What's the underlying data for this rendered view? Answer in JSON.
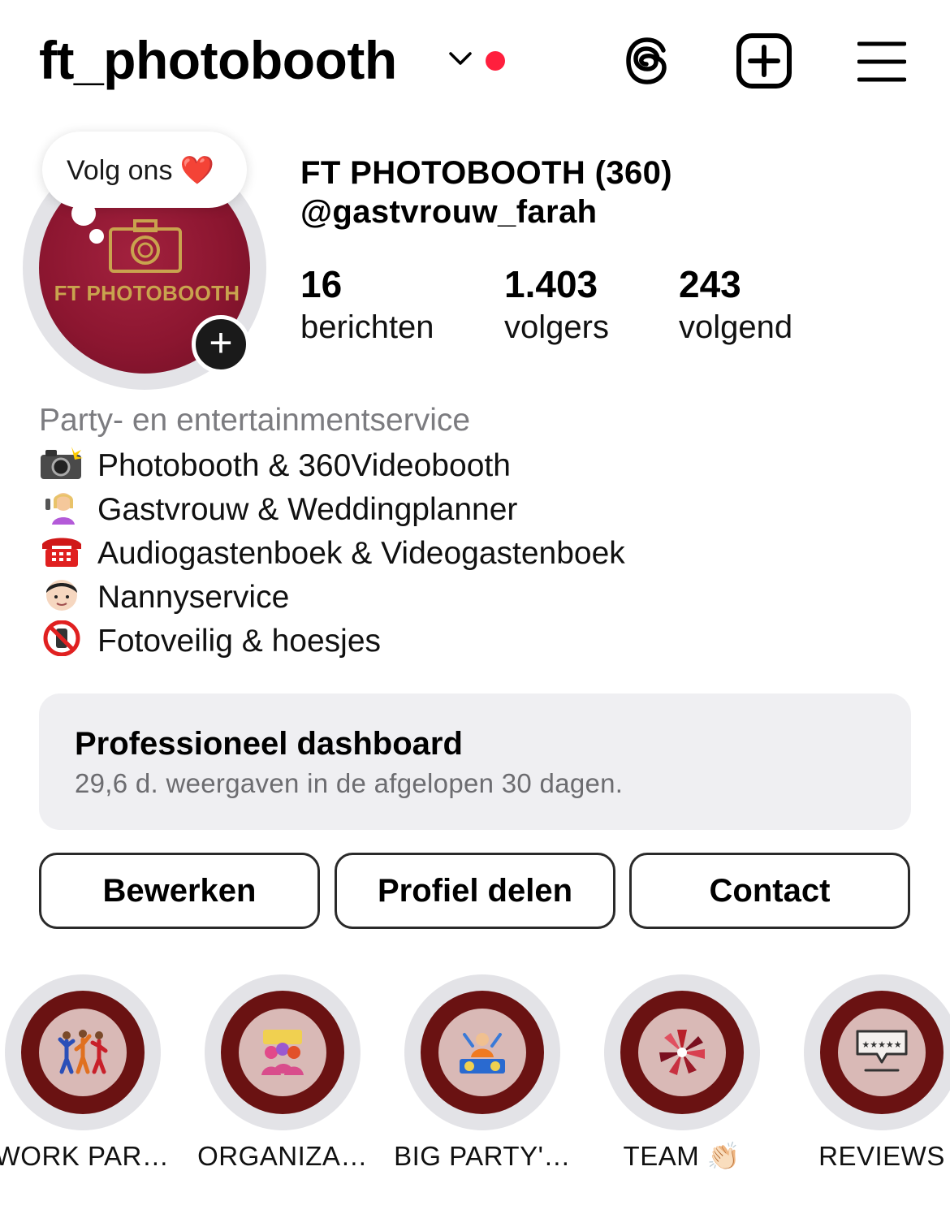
{
  "header": {
    "username": "ft_photobooth",
    "icons": [
      "chevron-down-icon",
      "notification-dot",
      "threads-icon",
      "new-post-icon",
      "menu-icon"
    ]
  },
  "note": {
    "text": "Volg ons ❤️"
  },
  "avatar": {
    "logo_text": "FT PHOTOBOOTH",
    "add_story_symbol": "+"
  },
  "profile": {
    "full_name": "FT PHOTOBOOTH (360)",
    "handle": "@gastvrouw_farah"
  },
  "stats": [
    {
      "value": "16",
      "label": "berichten"
    },
    {
      "value": "1.403",
      "label": "volgers"
    },
    {
      "value": "243",
      "label": "volgend"
    }
  ],
  "bio": {
    "category": "Party- en entertainmentservice",
    "lines": [
      {
        "emoji": "camera-flash-icon",
        "text": "Photobooth & 360Videobooth"
      },
      {
        "emoji": "woman-phone-icon",
        "text": "Gastvrouw & Weddingplanner"
      },
      {
        "emoji": "telephone-icon",
        "text": "Audiogastenboek & Videogastenboek"
      },
      {
        "emoji": "child-face-icon",
        "text": "Nannyservice"
      },
      {
        "emoji": "no-phone-icon",
        "text": "Fotoveilig & hoesjes"
      }
    ]
  },
  "dashboard": {
    "title": "Professioneel dashboard",
    "subtitle": "29,6 d. weergaven in de afgelopen 30 dagen."
  },
  "buttons": {
    "edit": "Bewerken",
    "share": "Profiel delen",
    "contact": "Contact"
  },
  "highlights": [
    {
      "label": "WORK PAR…",
      "icon": "dancers-icon"
    },
    {
      "label": "ORGANIZA…",
      "icon": "party-crowd-icon"
    },
    {
      "label": "BIG PARTY'…",
      "icon": "dj-icon"
    },
    {
      "label": "TEAM 👏🏻",
      "icon": "team-circle-icon"
    },
    {
      "label": "REVIEWS",
      "icon": "review-stars-icon"
    }
  ],
  "colors": {
    "accent_red": "#ff1f3d",
    "avatar_bg": "#8c1630",
    "logo_gold": "#c9a34e",
    "highlight_ring": "#6a1212",
    "highlight_inner": "#d9b9b6",
    "dashboard_bg": "#efeff2",
    "muted_text": "#6c6c70"
  }
}
